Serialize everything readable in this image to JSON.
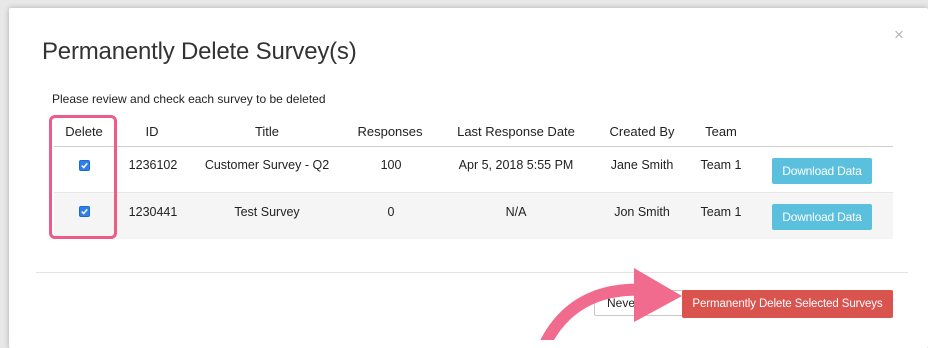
{
  "dialog": {
    "title": "Permanently Delete Survey(s)",
    "instructions": "Please review and check each survey to be deleted",
    "close_symbol": "×"
  },
  "table": {
    "headers": {
      "delete": "Delete",
      "id": "ID",
      "title": "Title",
      "responses": "Responses",
      "last_response_date": "Last Response Date",
      "created_by": "Created By",
      "team": "Team"
    },
    "rows": [
      {
        "checked": true,
        "id": "1236102",
        "title": "Customer Survey - Q2",
        "responses": "100",
        "last_response_date": "Apr 5, 2018 5:55 PM",
        "created_by": "Jane Smith",
        "team": "Team 1",
        "action_label": "Download Data"
      },
      {
        "checked": true,
        "id": "1230441",
        "title": "Test Survey",
        "responses": "0",
        "last_response_date": "N/A",
        "created_by": "Jon Smith",
        "team": "Team 1",
        "action_label": "Download Data"
      }
    ]
  },
  "footer": {
    "never_label": "Never",
    "delete_label": "Permanently Delete Selected Surveys"
  },
  "colors": {
    "highlight": "#ed5b88",
    "arrow": "#f06b8e",
    "download_button": "#5bc0de",
    "delete_button": "#d9534f",
    "checkbox": "#2f80ed"
  }
}
